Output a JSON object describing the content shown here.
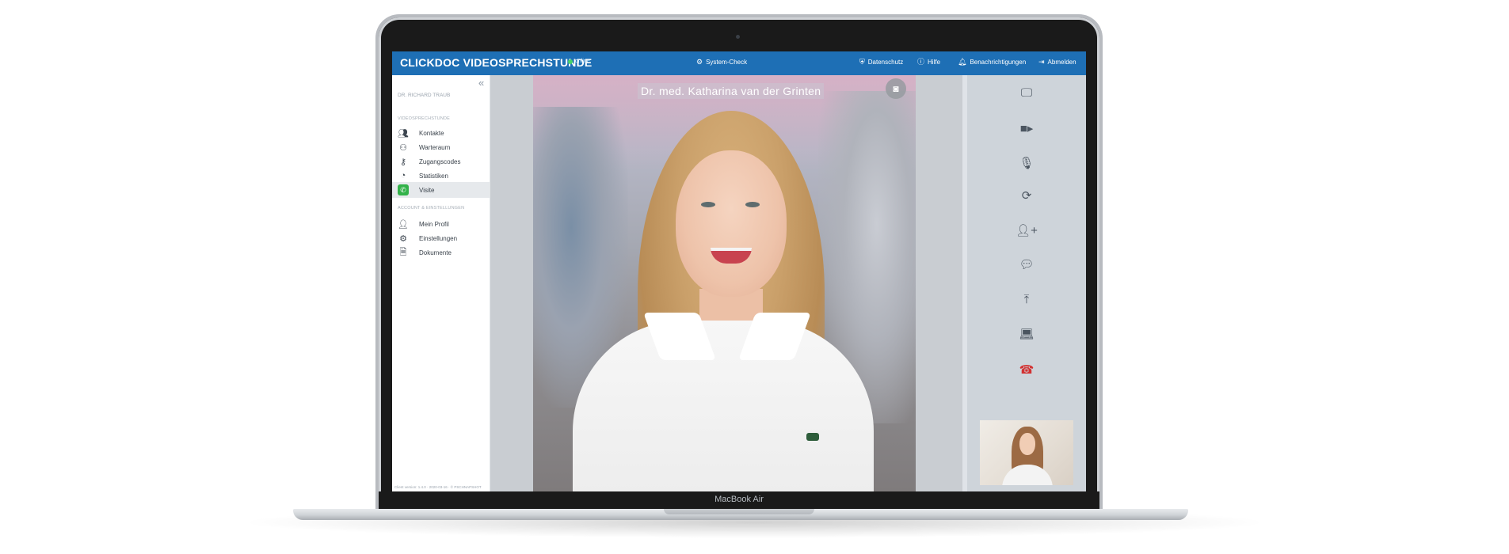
{
  "topbar": {
    "brand": "CLICKDOC VIDEOSPRECHSTUNDE",
    "status": "online",
    "system_check": "System-Check",
    "privacy": "Datenschutz",
    "help": "Hilfe",
    "notifications": "Benachrichtigungen",
    "logout": "Abmelden"
  },
  "sidebar": {
    "user": "DR. RICHARD TRAUB",
    "section1": "VIDEOSPRECHSTUNDE",
    "items": [
      {
        "label": "Kontakte",
        "icon": "contacts-icon"
      },
      {
        "label": "Warteraum",
        "icon": "waiting-room-icon"
      },
      {
        "label": "Zugangscodes",
        "icon": "key-icon"
      },
      {
        "label": "Statistiken",
        "icon": "chart-pie-icon"
      },
      {
        "label": "Visite",
        "icon": "phone-icon",
        "active": true
      }
    ],
    "section2": "ACCOUNT & EINSTELLUNGEN",
    "account_items": [
      {
        "label": "Mein Profil",
        "icon": "user-icon"
      },
      {
        "label": "Einstellungen",
        "icon": "gear-icon"
      },
      {
        "label": "Dokumente",
        "icon": "document-icon"
      }
    ],
    "footnote": "Client version: 1.4.0 · 2020-03-16 · © PSCHNAPSHOT"
  },
  "video": {
    "caption": "Dr. med. Katharina van der Grinten"
  },
  "controls": [
    "screen-share-icon",
    "camera-icon",
    "microphone-icon",
    "switch-camera-icon",
    "add-participant-icon",
    "chat-icon",
    "upload-icon",
    "laptop-icon",
    "hang-up-icon"
  ],
  "device": {
    "model": "MacBook Air"
  },
  "colors": {
    "topbar": "#1e6fb5",
    "active_green": "#33b24a",
    "hangup_red": "#d23232"
  }
}
